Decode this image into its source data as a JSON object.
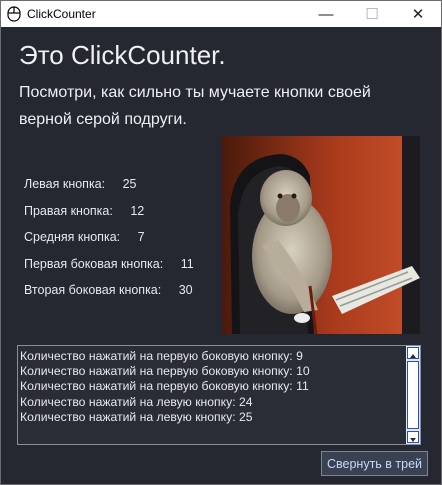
{
  "window": {
    "title": "ClickCounter",
    "controls": {
      "minimize": "—",
      "maximize": "☐",
      "close": "✕"
    }
  },
  "header": {
    "title": "Это ClickCounter.",
    "subtitle": "Посмотри, как сильно ты мучаете кнопки своей верной серой подруги."
  },
  "stats": [
    {
      "label": "Левая кнопка:",
      "value": "25"
    },
    {
      "label": "Правая кнопка:",
      "value": "12"
    },
    {
      "label": "Средняя кнопка:",
      "value": "7"
    },
    {
      "label": "Первая боковая кнопка:",
      "value": "11"
    },
    {
      "label": "Вторая боковая кнопка:",
      "value": "30"
    }
  ],
  "log": [
    "Количество нажатий на первую боковую кнопку: 9",
    "Количество нажатий на первую боковую кнопку: 10",
    "Количество нажатий на первую боковую кнопку: 11",
    "Количество нажатий на левую кнопку: 24",
    "Количество нажатий на левую кнопку: 25"
  ],
  "actions": {
    "minimize_to_tray": "Свернуть в трей"
  },
  "colors": {
    "background": "#252830",
    "text": "#eef0f4",
    "button_text": "#c9d6ff",
    "scrollbar_accent": "#1f4fd4"
  },
  "icons": {
    "app": "mouse-icon",
    "photo": "monkey-at-computer-image"
  }
}
